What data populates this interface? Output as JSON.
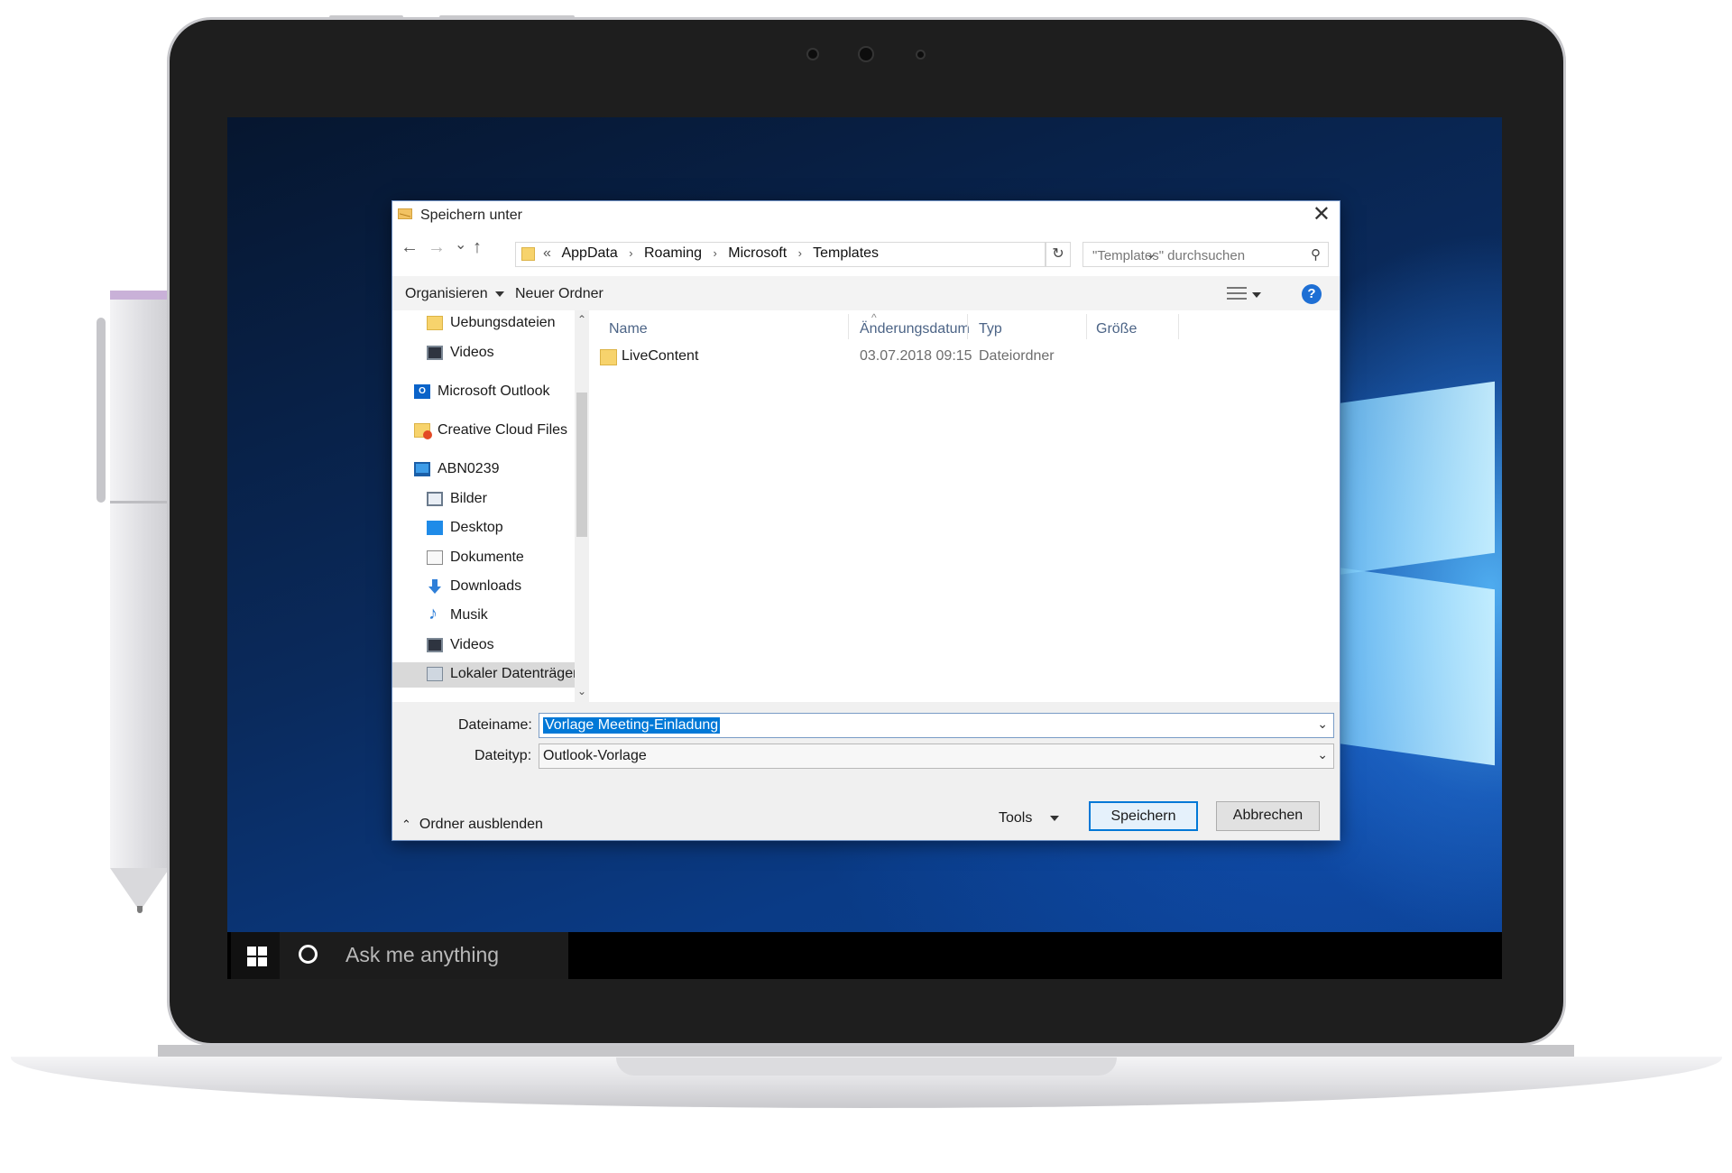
{
  "dialog": {
    "title": "Speichern unter",
    "close_glyph": "✕",
    "nav": {
      "back_glyph": "←",
      "forward_glyph": "→",
      "recent_glyph": "⌄",
      "up_glyph": "↑",
      "crumb_prefix": "«",
      "breadcrumbs": [
        "AppData",
        "Roaming",
        "Microsoft",
        "Templates"
      ],
      "crumb_sep": "›",
      "dropdown_glyph": "⌄",
      "refresh_glyph": "↻",
      "search_placeholder": "\"Templates\" durchsuchen",
      "search_glyph": "⚲"
    },
    "toolbar": {
      "organize": "Organisieren",
      "new_folder": "Neuer Ordner",
      "help": "?"
    },
    "sidebar": {
      "items": [
        {
          "label": "Uebungsdateien",
          "icon": "folder-icon"
        },
        {
          "label": "Videos",
          "icon": "videos-icon"
        },
        {
          "label": "Microsoft Outlook",
          "icon": "outlook-icon"
        },
        {
          "label": "Creative Cloud Files",
          "icon": "creative-cloud-icon"
        },
        {
          "label": "ABN0239",
          "icon": "computer-icon"
        },
        {
          "label": "Bilder",
          "icon": "pictures-icon"
        },
        {
          "label": "Desktop",
          "icon": "desktop-icon"
        },
        {
          "label": "Dokumente",
          "icon": "documents-icon"
        },
        {
          "label": "Downloads",
          "icon": "downloads-icon"
        },
        {
          "label": "Musik",
          "icon": "music-icon"
        },
        {
          "label": "Videos",
          "icon": "videos-icon"
        },
        {
          "label": "Lokaler Datenträger",
          "icon": "drive-icon"
        }
      ],
      "scroll_up": "⌃",
      "scroll_down": "⌄"
    },
    "filelist": {
      "sort_glyph": "^",
      "columns": [
        "Name",
        "Änderungsdatum",
        "Typ",
        "Größe"
      ],
      "rows": [
        {
          "name": "LiveContent",
          "date": "03.07.2018 09:15",
          "type": "Dateiordner",
          "size": ""
        }
      ]
    },
    "form": {
      "filename_label": "Dateiname:",
      "filename_value": "Vorlage Meeting-Einladung",
      "filetype_label": "Dateityp:",
      "filetype_value": "Outlook-Vorlage",
      "combo_glyph": "⌄"
    },
    "footer": {
      "hide_folders": "Ordner ausblenden",
      "hide_glyph": "⌃",
      "tools": "Tools",
      "save": "Speichern",
      "cancel": "Abbrechen"
    }
  },
  "taskbar": {
    "search_text": "Ask me anything"
  }
}
